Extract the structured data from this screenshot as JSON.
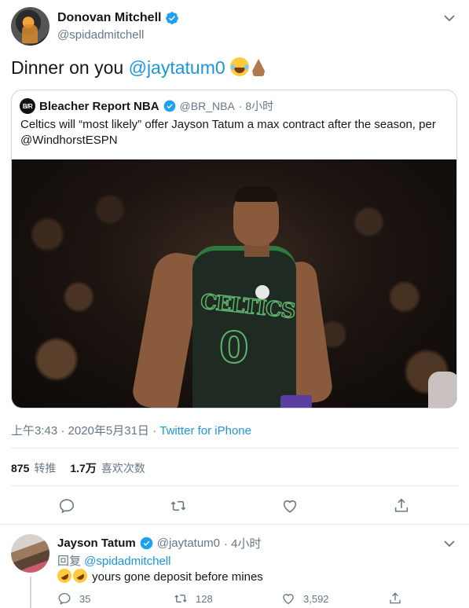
{
  "tweet": {
    "author": {
      "name": "Donovan Mitchell",
      "handle": "@spidadmitchell"
    },
    "text": {
      "prefix": "Dinner on you ",
      "mention": "@jaytatum0",
      "emojis": [
        "face-with-tears-of-joy",
        "folded-hands"
      ]
    },
    "quoted": {
      "logo_text": "B/R",
      "author_name": "Bleacher Report NBA",
      "handle": "@BR_NBA",
      "time": "· 8小时",
      "text": "Celtics will “most likely” offer Jayson Tatum a max contract after the season, per @WindhorstESPN",
      "image": {
        "jersey_text": "CELTICS",
        "jersey_number": "0"
      }
    },
    "meta": {
      "timestamp": "上午3:43 · 2020年5月31日 · ",
      "source": "Twitter for iPhone"
    },
    "stats": {
      "retweets_count": "875",
      "retweets_label": "转推",
      "likes_count": "1.7万",
      "likes_label": "喜欢次数"
    },
    "actions": [
      "reply-icon",
      "retweet-icon",
      "like-icon",
      "share-icon"
    ]
  },
  "reply": {
    "author": {
      "name": "Jayson Tatum",
      "handle": "@jaytatum0",
      "time": "· 4小时"
    },
    "reply_prefix": "回复 ",
    "reply_to": "@spidadmitchell",
    "emojis": [
      "rolling-on-the-floor-laughing",
      "rolling-on-the-floor-laughing"
    ],
    "text": "yours gone deposit before mines",
    "counts": {
      "replies": "35",
      "retweets": "128",
      "likes": "3,592"
    }
  },
  "colors": {
    "accent": "#1b95e0",
    "muted": "#657786",
    "text": "#14171a",
    "border": "#e6ecf0"
  }
}
